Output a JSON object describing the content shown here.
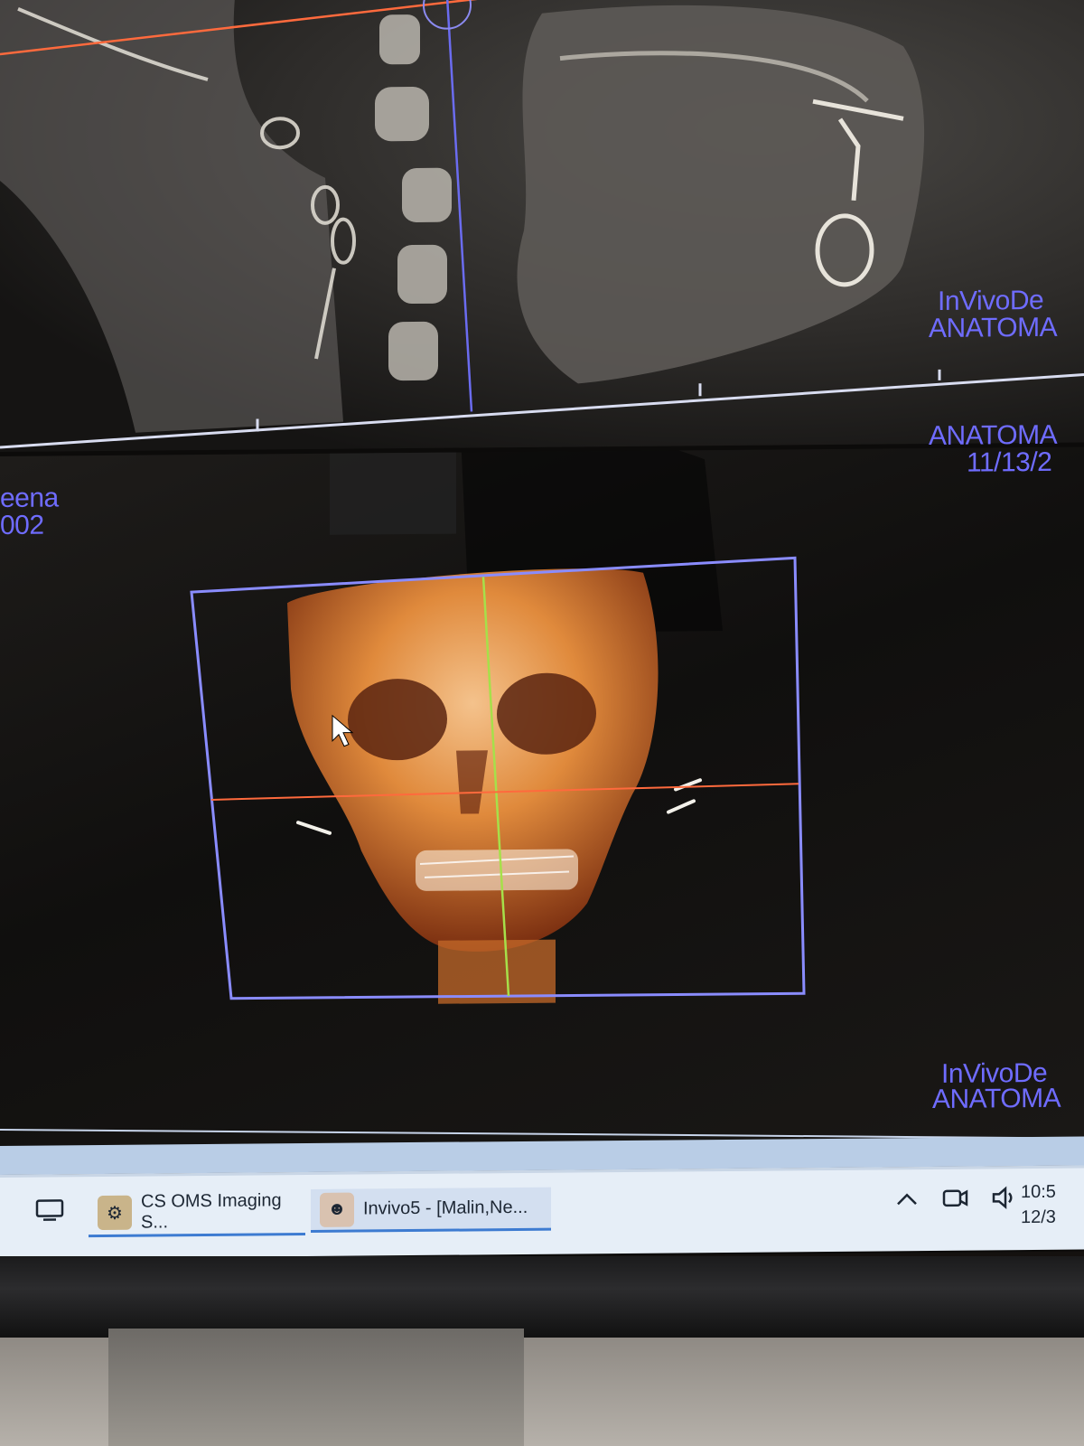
{
  "viewer": {
    "top_right_line1": "InVivoDe",
    "top_right_line2": "ANATOMA",
    "mid_right_line1": "ANATOMA",
    "mid_right_line2": "11/13/2",
    "left_line1": "eena",
    "left_line2": "002",
    "bottom_right_line1": "InVivoDe",
    "bottom_right_line2": "ANATOMA"
  },
  "taskbar": {
    "items": [
      {
        "label": "CS OMS Imaging S...",
        "icon": "cs-oms-app-icon"
      },
      {
        "label": "Invivo5 - [Malin,Ne...",
        "icon": "invivo-app-icon"
      }
    ],
    "clock_time": "10:5",
    "clock_date": "12/3"
  },
  "colors": {
    "overlay_text": "#6f6cff",
    "crosshair_vertical": "#6b6cf0",
    "crosshair_horizontal": "#ff6a3d",
    "volume_frame": "#8a8cff",
    "bone_render": "#e08a3c"
  }
}
